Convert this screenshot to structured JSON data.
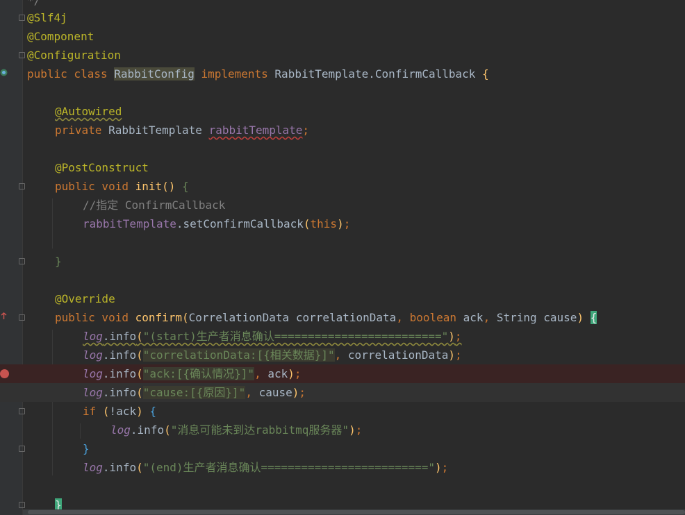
{
  "editor": {
    "lines": [
      "*/",
      "@Slf4j",
      "@Component",
      "@Configuration",
      "public class RabbitConfig implements RabbitTemplate.ConfirmCallback {",
      "",
      "@Autowired",
      "private RabbitTemplate rabbitTemplate;",
      "",
      "@PostConstruct",
      "public void init() {",
      "//指定 ConfirmCallback",
      "rabbitTemplate.setConfirmCallback(this);",
      "",
      "}",
      "",
      "@Override",
      "public void confirm(CorrelationData correlationData, boolean ack, String cause) {",
      "log.info(\"(start)生产者消息确认=========================\");",
      "log.info(\"correlationData:[{相关数据}]\", correlationData);",
      "log.info(\"ack:[{确认情况}]\", ack);",
      "log.info(\"cause:[{原因}]\", cause);",
      "if (!ack) {",
      "log.info(\"消息可能未到达rabbitmq服务器\");",
      "}",
      "log.info(\"(end)生产者消息确认=========================\");",
      "",
      "}"
    ],
    "tokens": {
      "class_name": "RabbitConfig",
      "iface": "RabbitTemplate.ConfirmCallback",
      "field_type": "RabbitTemplate",
      "field_name": "rabbitTemplate",
      "comment": "//指定 ConfirmCallback",
      "method_init": "init",
      "method_confirm": "confirm",
      "set_cb": "setConfirmCallback",
      "log": "log",
      "info": "info",
      "msg_start": "\"(start)生产者消息确认=========================\"",
      "msg_corr": "\"correlationData:[{相关数据}]\"",
      "msg_ack": "\"ack:[{确认情况}]\"",
      "msg_cause": "\"cause:[{原因}]\"",
      "msg_unreach": "\"消息可能未到达rabbitmq服务器\"",
      "msg_end": "\"(end)生产者消息确认=========================\"",
      "param1_type": "CorrelationData",
      "param1": "correlationData",
      "param2_type": "boolean",
      "param2": "ack",
      "param3_type": "String",
      "param3": "cause"
    },
    "colors": {
      "background": "#2b2b2b",
      "keyword": "#cc7832",
      "annotation": "#bbb529",
      "field": "#9876aa",
      "string": "#6a8759",
      "comment": "#808080",
      "method": "#ffc66d",
      "text": "#a9b7c6",
      "breakpoint": "#c75450"
    },
    "breakpoint_line": 21,
    "current_line": 22
  }
}
